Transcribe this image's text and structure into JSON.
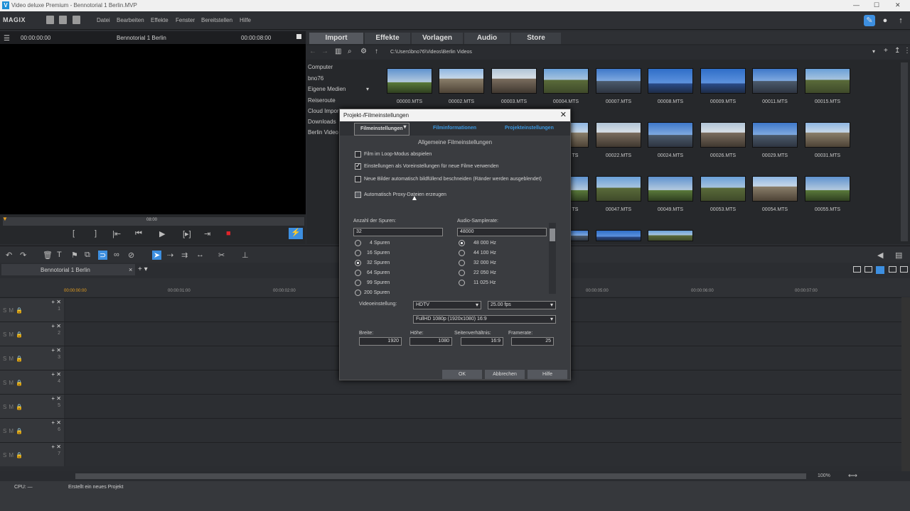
{
  "app": {
    "window_title": "Video deluxe Premium - Bennotorial 1 Berlin.MVP",
    "brand": "MAGIX",
    "menu": [
      "Datei",
      "Bearbeiten",
      "Effekte",
      "Fenster",
      "Bereitstellen",
      "Hilfe"
    ]
  },
  "preview": {
    "time_left": "00:00:00:00",
    "title": "Bennotorial 1 Berlin",
    "time_right": "00:00:08:00",
    "scrub_label": "08:00"
  },
  "media_tabs": [
    "Import",
    "Effekte",
    "Vorlagen",
    "Audio",
    "Store"
  ],
  "browser": {
    "path": "C:\\Users\\bno76\\Videos\\Berlin Videos",
    "tree": [
      "Computer",
      "bno76",
      "Eigene Medien",
      "Reiseroute",
      "Cloud Impor",
      "Downloads",
      "Berlin Video"
    ],
    "files_row1": [
      "00000.MTS",
      "00002.MTS",
      "00003.MTS",
      "00004.MTS",
      "00007.MTS",
      "00008.MTS",
      "00009.MTS",
      "00011.MTS",
      "00015.MTS"
    ],
    "files_row2": [
      "TS",
      "00022.MTS",
      "00024.MTS",
      "00026.MTS",
      "00029.MTS",
      "00031.MTS"
    ],
    "files_row3": [
      "TS",
      "00047.MTS",
      "00049.MTS",
      "00053.MTS",
      "00054.MTS",
      "00055.MTS"
    ]
  },
  "timeline": {
    "tab": "Bennotorial 1 Berlin",
    "ruler": [
      "00:00:00:00",
      "00:00:01:00",
      "00:00:02:00",
      "00:00:05:00",
      "00:00:06:00",
      "00:00:07:00"
    ],
    "tracks": [
      "1",
      "2",
      "3",
      "4",
      "5",
      "6",
      "7"
    ],
    "zoom": "100%"
  },
  "status": {
    "cpu": "CPU: —",
    "message": "Erstellt ein neues Projekt"
  },
  "dialog": {
    "title": "Projekt-/Filmeinstellungen",
    "tabs": [
      "Filmeinstellungen",
      "Filminformationen",
      "Projekteinstellungen"
    ],
    "section": "Allgemeine Filmeinstellungen",
    "options": [
      {
        "label": "Film im Loop-Modus abspielen",
        "checked": false
      },
      {
        "label": "Einstellungen als Voreinstellungen für neue Filme verwenden",
        "checked": true
      },
      {
        "label": "Neue Bilder automatisch bildfüllend beschneiden (Ränder werden ausgeblendet)",
        "checked": false
      },
      {
        "label": "Automatisch Proxy-Dateien erzeugen",
        "checked": false
      }
    ],
    "tracks_label": "Anzahl der Spuren:",
    "tracks_value": "32",
    "tracks_options": [
      "4 Spuren",
      "16 Spuren",
      "32 Spuren",
      "64 Spuren",
      "99 Spuren",
      "200 Spuren"
    ],
    "tracks_selected": "32 Spuren",
    "audio_label": "Audio-Samplerate:",
    "audio_value": "48000",
    "audio_options": [
      "48 000 Hz",
      "44 100 Hz",
      "32 000 Hz",
      "22 050 Hz",
      "11 025 Hz"
    ],
    "audio_selected": "48 000 Hz",
    "video_label": "Videoeinstellung:",
    "video_standard": "HDTV",
    "fps": "25.00 fps",
    "resolution": "FullHD 1080p (1920x1080) 16:9",
    "width_label": "Breite:",
    "width": "1920",
    "height_label": "Höhe:",
    "height": "1080",
    "aspect_label": "Seitenverhältnis:",
    "aspect": "16:9",
    "framerate_label": "Framerate:",
    "framerate": "25",
    "ok": "OK",
    "cancel": "Abbrechen",
    "help": "Hilfe"
  }
}
